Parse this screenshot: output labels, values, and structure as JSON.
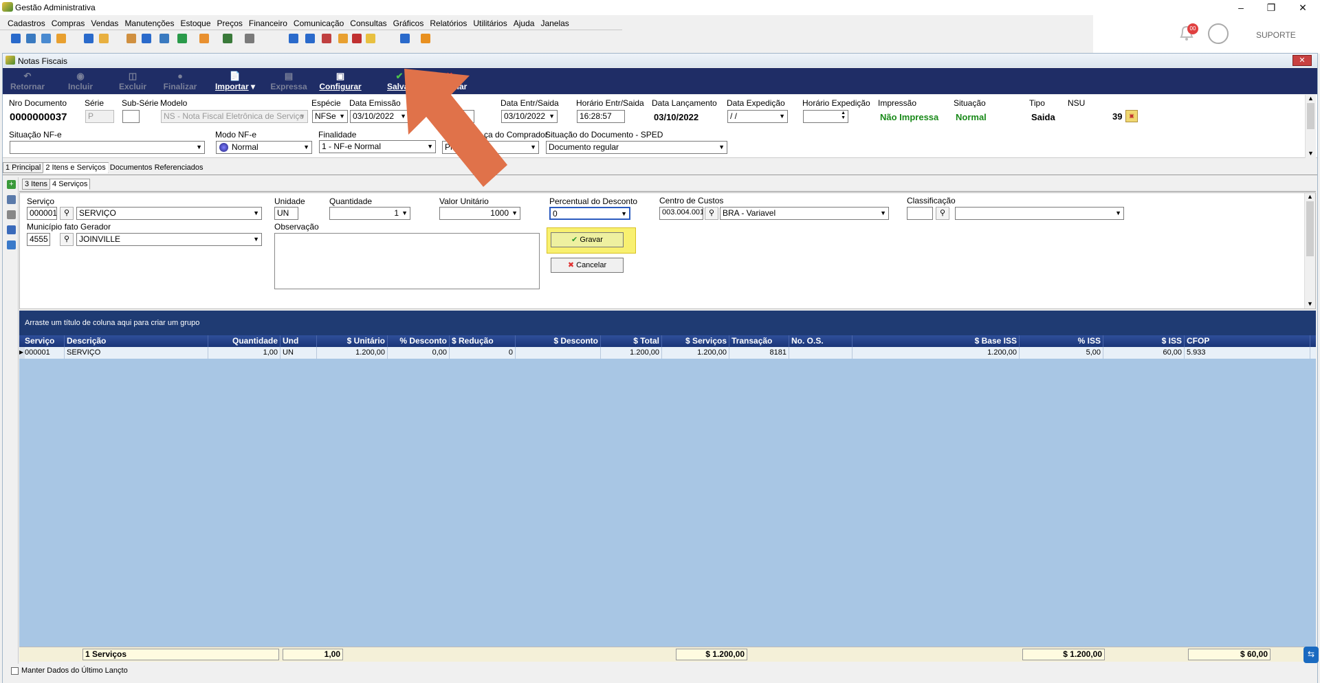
{
  "app": {
    "title": "Gestão Administrativa",
    "user": "SUPORTE",
    "notifications": "00"
  },
  "menu": [
    "Cadastros",
    "Compras",
    "Vendas",
    "Manutenções",
    "Estoque",
    "Preços",
    "Financeiro",
    "Comunicação",
    "Consultas",
    "Gráficos",
    "Relatórios",
    "Utilitários",
    "Ajuda",
    "Janelas"
  ],
  "window": {
    "title": "Notas Fiscais"
  },
  "nav": {
    "retornar": "Retornar",
    "incluir": "Incluir",
    "excluir": "Excluir",
    "finalizar": "Finalizar",
    "importar": "Importar",
    "expressa": "Expressa",
    "configurar": "Configurar",
    "salvar": "Salvar",
    "cancelar": "Cancelar"
  },
  "header": {
    "nro_documento_label": "Nro Documento",
    "nro_documento": "0000000037",
    "serie_label": "Série",
    "serie": "P",
    "sub_serie_label": "Sub-Série",
    "sub_serie": "",
    "modelo_label": "Modelo",
    "modelo": "NS - Nota Fiscal Eletrônica de Serviço",
    "especie_label": "Espécie",
    "especie": "NFSe",
    "data_emissao_label": "Data Emissão",
    "data_emissao": "03/10/2022",
    "hora_emissao_fragment": "00",
    "data_entr_label": "Data Entr/Saida",
    "data_entr": "03/10/2022",
    "horario_entr_label": "Horário Entr/Saida",
    "horario_entr": "16:28:57",
    "data_lanc_label": "Data Lançamento",
    "data_lanc": "03/10/2022",
    "data_exp_label": "Data Expedição",
    "data_exp": " / /",
    "horario_exp_label": "Horário Expedição",
    "horario_exp": "",
    "impressao_label": "Impressão",
    "impressao": "Não Impressa",
    "situacao_label": "Situação",
    "situacao": "Normal",
    "tipo_label": "Tipo",
    "tipo": "Saida",
    "nsu_label": "NSU",
    "nsu": "39",
    "situacao_nfe_label": "Situação NF-e",
    "situacao_nfe": "",
    "modo_nfe_label": "Modo NF-e",
    "modo_nfe": "Normal",
    "finalidade_label": "Finalidade",
    "finalidade": "1 - NF-e Normal",
    "presenca_label": "ça do Comprador",
    "presenca": "Presencial",
    "situacao_doc_label": "Situação do Documento - SPED",
    "situacao_doc": "Documento regular"
  },
  "tabs": {
    "principal": "1 Principal",
    "itens_servicos": "2 Itens e Serviços",
    "docs_ref": "Documentos Referenciados",
    "itens": "3 Itens",
    "servicos": "4 Serviços"
  },
  "form": {
    "servico_label": "Serviço",
    "servico_code": "000001",
    "servico_name": "SERVIÇO",
    "unidade_label": "Unidade",
    "unidade": "UN",
    "quantidade_label": "Quantidade",
    "quantidade": "1",
    "valor_unit_label": "Valor Unitário",
    "valor_unit": "1000",
    "perc_desc_label": "Percentual do Desconto",
    "perc_desc": "0",
    "centro_label": "Centro de Custos",
    "centro_code": "003.004.001",
    "centro_name": "BRA - Variavel",
    "classificacao_label": "Classificação",
    "classificacao_code": "",
    "classificacao_name": "",
    "municipio_label": "Município fato Gerador",
    "municipio_code": "4555",
    "municipio_name": "JOINVILLE",
    "observacao_label": "Observação",
    "observacao": "",
    "gravar": "Gravar",
    "cancelar": "Cancelar"
  },
  "grid": {
    "group_hint": "Arraste um título de coluna aqui para criar um grupo",
    "columns": [
      "Serviço",
      "Descrição",
      "Quantidade",
      "Und",
      "$ Unitário",
      "% Desconto",
      "$ Redução",
      "$ Desconto",
      "$ Total",
      "$ Serviços",
      "Transação",
      "No. O.S.",
      "$ Base ISS",
      "% ISS",
      "$ ISS",
      "CFOP"
    ],
    "rows": [
      [
        "000001",
        "SERVIÇO",
        "1,00",
        "UN",
        "1.200,00",
        "0,00",
        "0",
        "",
        "1.200,00",
        "1.200,00",
        "8181",
        "",
        "1.200,00",
        "5,00",
        "60,00",
        "5.933"
      ]
    ],
    "footer": {
      "count": "1 Serviços",
      "quantidade": "1,00",
      "total": "$ 1.200,00",
      "base_iss": "$ 1.200,00",
      "iss": "$ 60,00"
    }
  },
  "status": {
    "manter": "Manter Dados do Último Lançto"
  }
}
